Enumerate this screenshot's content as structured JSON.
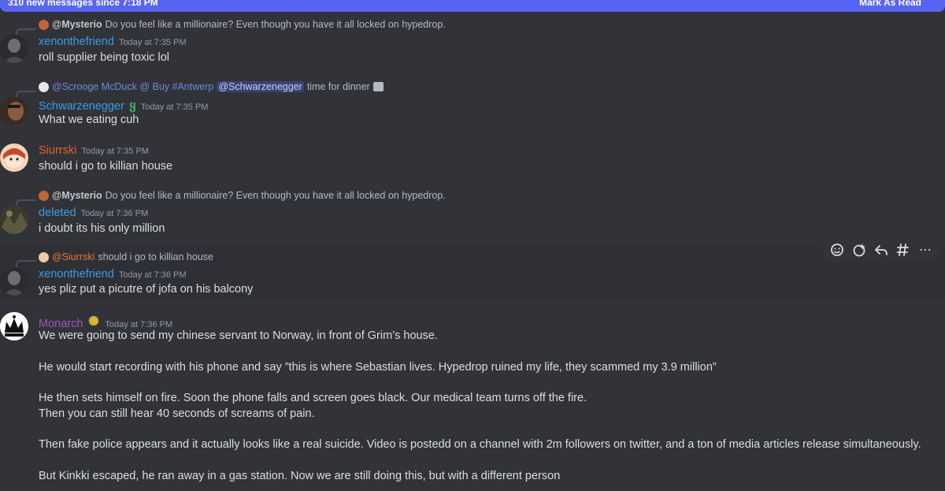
{
  "banner": {
    "new_messages": "310 new messages since 7:18 PM",
    "mark_as_read": "Mark As Read"
  },
  "messages": [
    {
      "reply": {
        "name": "@Mysterio",
        "text": "Do you feel like a millionaire? Even though you have it all locked on hypedrop."
      },
      "author": "xenonthefriend",
      "author_color": "#3c9ce6",
      "time": "Today at 7:35 PM",
      "content": "roll supplier being toxic lol"
    },
    {
      "reply": {
        "name": "@Scrooge McDuck @ Buy #Antwerp",
        "mention": "@Schwarzenegger",
        "text": "time for dinner"
      },
      "author": "Schwarzenegger",
      "author_color": "#3c9ce6",
      "time": "Today at 7:35 PM",
      "content": "What we eating cuh"
    },
    {
      "author": "Siurrski",
      "author_color": "#e0632e",
      "time": "Today at 7:35 PM",
      "content": "should i go to killian house"
    },
    {
      "reply": {
        "name": "@Mysterio",
        "text": "Do you feel like a millionaire? Even though you have it all locked on hypedrop."
      },
      "author": "deleted",
      "author_color": "#3c9ce6",
      "time": "Today at 7:36 PM",
      "content": "i doubt its his only million"
    },
    {
      "reply": {
        "name": "@Siurrski",
        "text": "should i go to killian house"
      },
      "author": "xenonthefriend",
      "author_color": "#3c9ce6",
      "time": "Today at 7:36 PM",
      "content": "yes pliz put a picutre of jofa on his balcony"
    },
    {
      "author": "Monarch",
      "author_color": "#9b59b6",
      "time": "Today at 7:36 PM",
      "lines": [
        "We were going to send my chinese servant to Norway, in front of Grim’s house.",
        "He would start recording with his phone and say ”this is where Sebastian lives. Hypedrop ruined my life, they scammed my 3.9 million”",
        "He then sets himself on fire. Soon the phone falls and screen goes black. Our medical team turns off the fire.",
        "Then you can still hear 40 seconds of screams of pain.",
        "Then fake police appears and it actually looks like a real suicide. Video is postedd on a channel with 2m followers on twitter, and a ton of media articles release simultaneously.",
        "But Kinkki escaped, he ran away in a gas station. Now we are still doing this, but with a different person"
      ]
    }
  ],
  "toolbar": {
    "icons": [
      "add-reaction-icon",
      "super-reaction-icon",
      "reply-icon",
      "create-thread-icon",
      "more-icon"
    ],
    "more": "⋯"
  }
}
